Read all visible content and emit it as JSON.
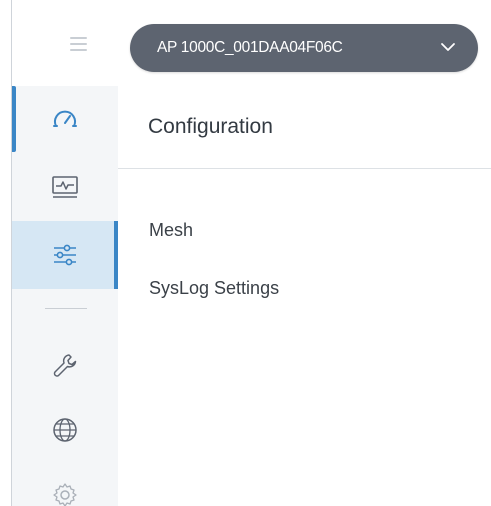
{
  "header": {
    "device_select": {
      "value": "AP 1000C_001DAA04F06C"
    },
    "hamburger_icon": "menu-icon",
    "chevron_icon": "chevron-down-icon"
  },
  "sidebar": {
    "items": [
      {
        "name": "dashboard",
        "icon": "speedometer-icon"
      },
      {
        "name": "monitoring",
        "icon": "monitor-pulse-icon"
      },
      {
        "name": "configuration",
        "icon": "sliders-icon",
        "selected": true
      },
      {
        "name": "tools",
        "icon": "wrench-icon"
      },
      {
        "name": "network",
        "icon": "globe-icon"
      },
      {
        "name": "settings",
        "icon": "gear-icon"
      }
    ]
  },
  "main": {
    "title": "Configuration",
    "menu": [
      {
        "label": "Mesh"
      },
      {
        "label": "SysLog Settings"
      }
    ]
  },
  "colors": {
    "accent": "#3a86c6",
    "selected_bg": "#d6e7f4",
    "select_bg": "#5d6470",
    "sidebar_bg": "#f4f6f8"
  }
}
